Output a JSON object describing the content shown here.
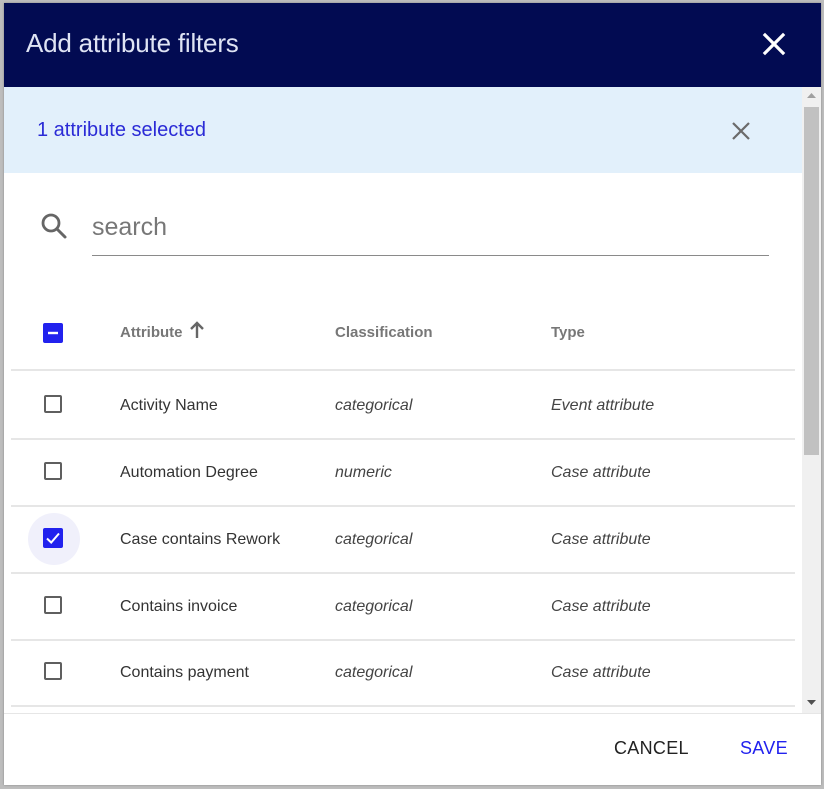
{
  "dialog": {
    "title": "Add attribute filters",
    "close_icon": "close-icon"
  },
  "banner": {
    "text": "1 attribute selected",
    "clear_icon": "close-icon"
  },
  "search": {
    "placeholder": "search",
    "value": "",
    "icon": "search-icon"
  },
  "table": {
    "select_all_state": "indeterminate",
    "columns": [
      {
        "label": "Attribute",
        "sort": "ascending"
      },
      {
        "label": "Classification"
      },
      {
        "label": "Type"
      }
    ],
    "rows": [
      {
        "attribute": "Activity Name",
        "classification": "categorical",
        "type": "Event attribute",
        "checked": false
      },
      {
        "attribute": "Automation Degree",
        "classification": "numeric",
        "type": "Case attribute",
        "checked": false
      },
      {
        "attribute": "Case contains Rework",
        "classification": "categorical",
        "type": "Case attribute",
        "checked": true
      },
      {
        "attribute": "Contains invoice",
        "classification": "categorical",
        "type": "Case attribute",
        "checked": false
      },
      {
        "attribute": "Contains payment",
        "classification": "categorical",
        "type": "Case attribute",
        "checked": false
      }
    ]
  },
  "footer": {
    "cancel_label": "CANCEL",
    "save_label": "SAVE"
  },
  "colors": {
    "header_bg": "#020b52",
    "accent": "#2222ee",
    "banner_bg": "#e2f0fb"
  }
}
